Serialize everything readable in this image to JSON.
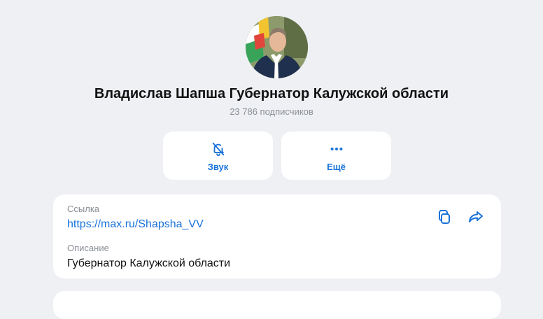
{
  "channel": {
    "name": "Владислав Шапша Губернатор Калужской области",
    "subscribers": "23 786 подписчиков"
  },
  "actions": [
    {
      "label": "Звук",
      "icon": "bell-off-icon"
    },
    {
      "label": "Ещё",
      "icon": "more-dots-icon"
    }
  ],
  "info": {
    "link_label": "Ссылка",
    "link_value": "https://max.ru/Shapsha_VV",
    "description_label": "Описание",
    "description_value": "Губернатор Калужской области",
    "copy_icon": "copy-icon",
    "share_icon": "share-icon"
  },
  "colors": {
    "accent": "#1a73d9",
    "background": "#eef0f3",
    "card": "#ffffff",
    "muted": "#8a8f96"
  }
}
